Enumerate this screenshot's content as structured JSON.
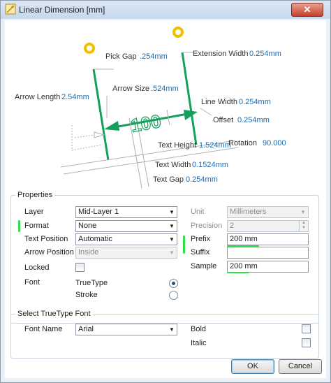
{
  "window": {
    "title": "Linear Dimension [mm]",
    "close_glyph": "✕"
  },
  "diagram": {
    "pick_gap": {
      "label": "Pick Gap",
      "value": ".254mm"
    },
    "extension_width": {
      "label": "Extension Width",
      "value": "0.254mm"
    },
    "arrow_size": {
      "label": "Arrow Size",
      "value": ".524mm"
    },
    "arrow_length": {
      "label": "Arrow Length",
      "value": "2.54mm"
    },
    "line_width": {
      "label": "Line Width",
      "value": "0.254mm"
    },
    "offset": {
      "label": "Offset",
      "value": "0.254mm"
    },
    "text_height": {
      "label": "Text Height",
      "value": "1.524mm"
    },
    "rotation": {
      "label": "Rotation",
      "value": "90.000"
    },
    "text_width": {
      "label": "Text Width",
      "value": "0.1524mm"
    },
    "text_gap": {
      "label": "Text Gap",
      "value": "0.254mm"
    },
    "dimension_text": "100"
  },
  "properties": {
    "legend": "Properties",
    "layer": {
      "label": "Layer",
      "value": "Mid-Layer 1"
    },
    "format": {
      "label": "Format",
      "value": "None"
    },
    "text_position": {
      "label": "Text Position",
      "value": "Automatic"
    },
    "arrow_position": {
      "label": "Arrow Position",
      "value": "Inside"
    },
    "locked": {
      "label": "Locked",
      "checked": false
    },
    "font": {
      "label": "Font",
      "truetype": "TrueType",
      "stroke": "Stroke",
      "selected": "TrueType"
    },
    "unit": {
      "label": "Unit",
      "value": "Millimeters"
    },
    "precision": {
      "label": "Precision",
      "value": "2"
    },
    "prefix": {
      "label": "Prefix",
      "value": "200 mm"
    },
    "suffix": {
      "label": "Suffix",
      "value": ""
    },
    "sample": {
      "label": "Sample",
      "value": "200 mm"
    }
  },
  "truetype_font": {
    "legend": "Select TrueType Font",
    "font_name": {
      "label": "Font Name",
      "value": "Arial"
    },
    "bold": {
      "label": "Bold",
      "checked": false
    },
    "italic": {
      "label": "Italic",
      "checked": false
    }
  },
  "buttons": {
    "ok": "OK",
    "cancel": "Cancel"
  },
  "colors": {
    "dimension_green": "#12a05a",
    "value_blue": "#1b6bb3",
    "highlight_green": "#2ee04a",
    "pad_yellow": "#f0c000"
  }
}
